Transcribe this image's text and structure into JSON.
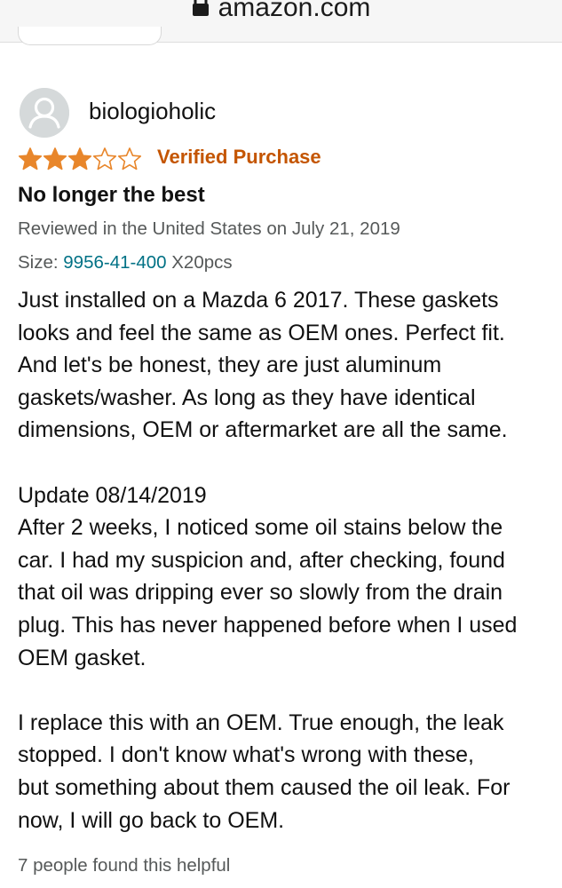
{
  "browser": {
    "url": "amazon.com",
    "lock_icon": "lock-icon"
  },
  "review": {
    "avatar_icon": "user-avatar-icon",
    "username": "biologioholic",
    "rating": 3,
    "rating_max": 5,
    "star_color": "#e8862b",
    "verified_label": "Verified Purchase",
    "verified_color": "#c45500",
    "title": "No longer the best",
    "meta": "Reviewed in the United States on July 21, 2019",
    "size_label": "Size:",
    "size_value": "9956-41-400",
    "size_suffix": "X20pcs",
    "link_color": "#007185",
    "paragraph1": [
      "Just installed on a Mazda 6 2017. These gaskets",
      "looks and feel the same as OEM ones. Perfect fit.",
      "And let's be honest, they are just aluminum",
      "gaskets/washer. As long as they have identical",
      "dimensions, OEM or aftermarket are all the same."
    ],
    "update_heading": "Update 08/14/2019",
    "paragraph2": [
      "After 2 weeks, I noticed some oil stains below the",
      "car. I had my suspicion and, after checking, found",
      "that oil was dripping ever so slowly from the drain",
      "plug. This has never happened before when I used",
      "OEM gasket."
    ],
    "paragraph3": [
      "I replace this with an OEM. True enough, the leak",
      "stopped. I don't know what's wrong with these,",
      "but something about them caused the oil leak. For",
      "now, I will go back to OEM."
    ],
    "helpful_text": "7 people found this helpful"
  }
}
